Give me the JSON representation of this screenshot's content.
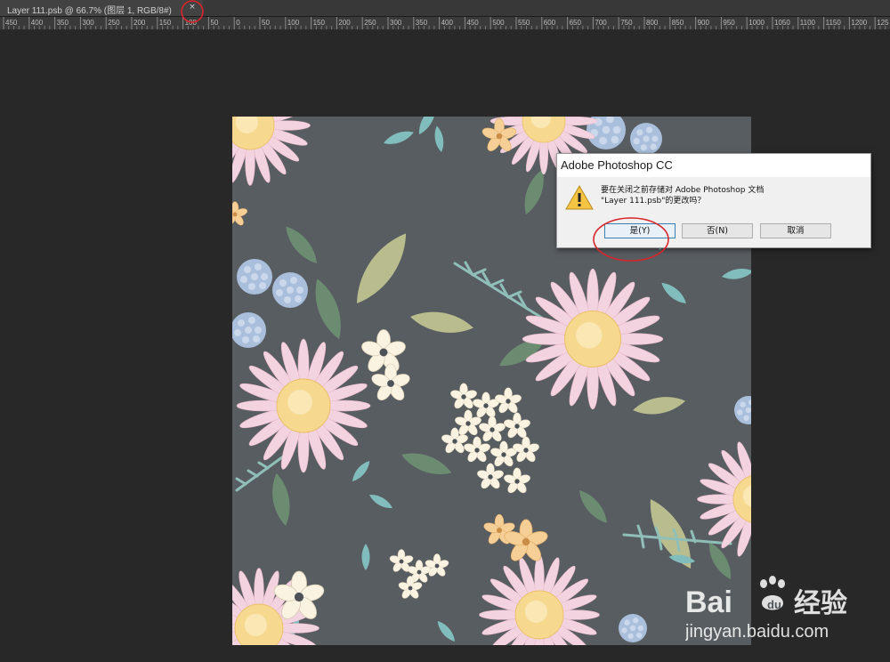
{
  "document_tab": {
    "title": "Layer 111.psb @ 66.7% (图层 1, RGB/8#)",
    "close_glyph": "×"
  },
  "ruler": {
    "labels": [
      "450",
      "400",
      "350",
      "300",
      "250",
      "200",
      "150",
      "100",
      "50",
      "0",
      "50",
      "100",
      "150",
      "200",
      "250",
      "300",
      "350",
      "400",
      "450",
      "500",
      "550",
      "600",
      "650",
      "700",
      "750",
      "800",
      "850",
      "900",
      "950",
      "1000",
      "1050",
      "1100",
      "1150",
      "1200",
      "125"
    ]
  },
  "dialog": {
    "title": "Adobe Photoshop CC",
    "message_line1": "要在关闭之前存储对 Adobe Photoshop 文档",
    "message_line2": "\"Layer 111.psb\"的更改吗？",
    "buttons": {
      "yes": "是(Y)",
      "no": "否(N)",
      "cancel": "取消"
    },
    "icon": "warning-icon"
  },
  "watermark": {
    "brand": "Bai du 经验",
    "url": "jingyan.baidu.com"
  },
  "colors": {
    "canvas_bg": "#585d62",
    "petal_pink": "#f3d3df",
    "flower_center": "#f6d98f",
    "leaf_green": "#6e8f73",
    "leaf_teal": "#82bdbd",
    "annotation_red": "#d9242a"
  }
}
